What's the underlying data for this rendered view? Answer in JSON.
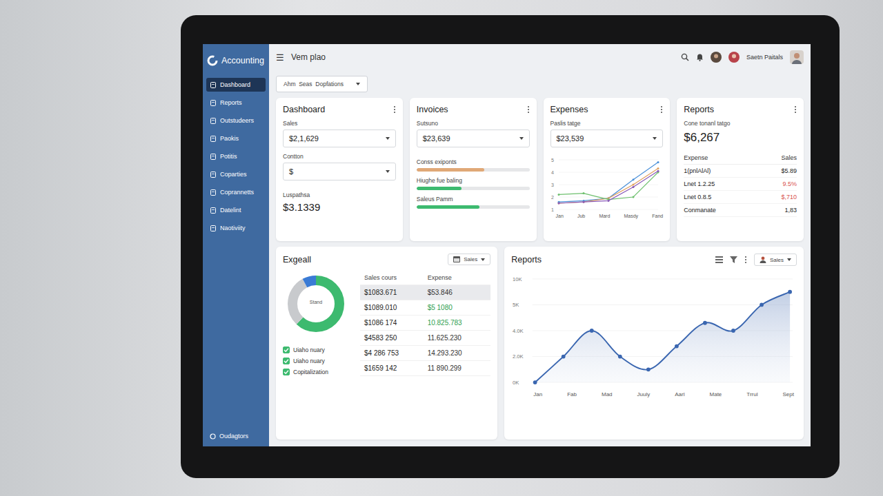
{
  "app": {
    "logo": "Accounting"
  },
  "topbar": {
    "menu_icon": "☰",
    "title": "Vem plao",
    "user_name": "Saetn Paitals"
  },
  "sidebar": {
    "items": [
      {
        "label": "Dashboard",
        "selected": true
      },
      {
        "label": "Reports",
        "selected": false
      },
      {
        "label": "Outstudeers",
        "selected": false
      },
      {
        "label": "Paokis",
        "selected": false
      },
      {
        "label": "Potitis",
        "selected": false
      },
      {
        "label": "Coparties",
        "selected": false
      },
      {
        "label": "Coprannetts",
        "selected": false
      },
      {
        "label": "Datelint",
        "selected": false
      },
      {
        "label": "Naotiviity",
        "selected": false
      }
    ],
    "footer": "Oudagtors"
  },
  "filter": {
    "label": "Ahm  Seas  Dopfations"
  },
  "dashboard_card": {
    "title": "Dashboard",
    "fields": [
      {
        "label": "Sales",
        "value": "$2,1,629"
      },
      {
        "label": "Contton",
        "value": "$"
      }
    ],
    "total_label": "Luspathsa",
    "total": "$3.1339"
  },
  "invoices_card": {
    "title": "Invoices",
    "field": {
      "label": "Sutsuno",
      "value": "$23,639"
    },
    "bars": [
      {
        "label": "Conss exiponts",
        "level": 0.6,
        "color": "#e0a877"
      },
      {
        "label": "Hiughe fue baling",
        "level": 0.4,
        "color": "#3dba6f"
      },
      {
        "label": "Saleus Pamm",
        "level": 0.56,
        "color": "#3dba6f"
      }
    ]
  },
  "expenses_card": {
    "title": "Expenses",
    "field": {
      "label": "Paslis tatge",
      "value": "$23,539"
    },
    "chart": {
      "y_ticks": [
        "5",
        "4",
        "3",
        "2",
        "1"
      ],
      "x_labels": [
        "Jan",
        "Jub",
        "Mard",
        "Masdy",
        "Fand"
      ],
      "series": [
        {
          "values": [
            1.6,
            1.7,
            1.9,
            3.4,
            4.8
          ],
          "color": "#4a90d9"
        },
        {
          "values": [
            1.5,
            1.6,
            1.9,
            3.0,
            4.3
          ],
          "color": "#e0a060"
        },
        {
          "values": [
            2.2,
            2.3,
            1.8,
            2.0,
            4.0
          ],
          "color": "#6cbf6c"
        },
        {
          "values": [
            1.5,
            1.6,
            1.7,
            2.8,
            4.1
          ],
          "color": "#8a5ab8"
        }
      ]
    }
  },
  "reports_card": {
    "title": "Reports",
    "subtitle": "Cone tonanl tatgo",
    "amount": "$6,267",
    "columns": [
      "Expense",
      "Sales"
    ],
    "rows": [
      {
        "label": "1(pnlAlAl)",
        "value": "$5.89",
        "color": "#222222"
      },
      {
        "label": "Lnet 1.2.25",
        "value": "9.5%",
        "color": "#d9534f"
      },
      {
        "label": "Lnet 0.8.5",
        "value": "$,710",
        "color": "#d9534f"
      },
      {
        "label": "Conmanate",
        "value": "1,83",
        "color": "#222222"
      }
    ]
  },
  "summary_card": {
    "title": "Exgeall",
    "dropdown": "Sales",
    "donut": {
      "center": "Stand",
      "segments": [
        {
          "level": 0.62,
          "color": "#3dba6f"
        },
        {
          "level": 0.3,
          "color": "#c8cacd"
        },
        {
          "level": 0.08,
          "color": "#3a7bd5"
        }
      ]
    },
    "columns": [
      "Sales cours",
      "Expense"
    ],
    "rows": [
      {
        "sales": "$1083.671",
        "expense": "$53.846",
        "selected": true,
        "color": "#333333"
      },
      {
        "sales": "$1089.010",
        "expense": "$5 1080",
        "selected": false,
        "color": "#2e9e4f"
      },
      {
        "sales": "$1086 174",
        "expense": "10.825.783",
        "selected": false,
        "color": "#2e9e4f"
      },
      {
        "sales": "$4583 250",
        "expense": "11.625.230",
        "selected": false,
        "color": "#333333"
      },
      {
        "sales": "$4 286 753",
        "expense": "14.293.230",
        "selected": false,
        "color": "#333333"
      },
      {
        "sales": "$1659 142",
        "expense": "11 890.299",
        "selected": false,
        "color": "#333333"
      }
    ],
    "checks": [
      {
        "label": "Uiaho nuary",
        "checked": true
      },
      {
        "label": "Uiaho nuary",
        "checked": true
      },
      {
        "label": "Copitalization",
        "checked": true
      }
    ]
  },
  "reports_chart": {
    "title": "Reports",
    "dropdown": "Sales",
    "y_ticks": [
      "10K",
      "5K",
      "4.0K",
      "2.0K",
      "0K"
    ],
    "x_labels": [
      "Jan",
      "Fab",
      "Mad",
      "Juuly",
      "Aarl",
      "Mate",
      "Trrul",
      "Sept"
    ],
    "values": [
      0,
      2.0,
      4.0,
      2.0,
      1.0,
      2.8,
      4.3,
      4.0,
      5.0,
      7.5
    ]
  }
}
